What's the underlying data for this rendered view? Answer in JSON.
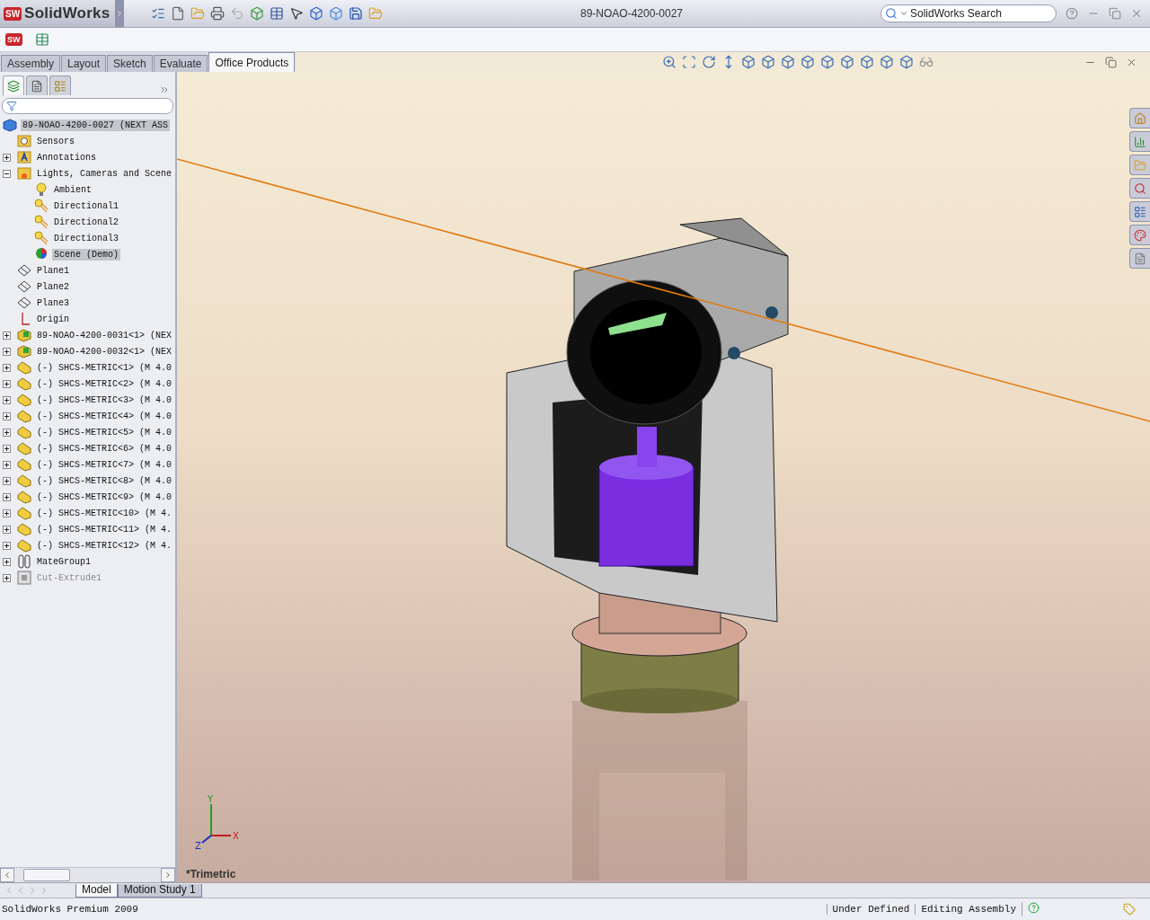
{
  "app": {
    "logo_mark": "SW",
    "logo": "SolidWorks",
    "document_title": "89-NOAO-4200-0027",
    "search": {
      "placeholder": "SolidWorks Search"
    },
    "menu_mark": "SW"
  },
  "command_tabs": [
    {
      "label": "Assembly",
      "selected": false
    },
    {
      "label": "Layout",
      "selected": false
    },
    {
      "label": "Sketch",
      "selected": false
    },
    {
      "label": "Evaluate",
      "selected": false
    },
    {
      "label": "Office Products",
      "selected": true
    }
  ],
  "panel_tabs": [
    {
      "kind": "feature-manager",
      "selected": true
    },
    {
      "kind": "property-manager",
      "selected": false
    },
    {
      "kind": "configuration-manager",
      "selected": false
    }
  ],
  "tree": {
    "root": {
      "label": "89-NOAO-4200-0027  (NEXT ASS",
      "kind": "assembly",
      "selected": true
    },
    "items": [
      {
        "label": "Sensors",
        "kind": "sensors",
        "selected": false
      },
      {
        "label": "Annotations",
        "kind": "annotations",
        "selected": false,
        "expanded": false
      },
      {
        "label": "Lights, Cameras and Scene",
        "kind": "lights",
        "selected": false,
        "expanded": true,
        "children": [
          {
            "label": "Ambient",
            "kind": "ambient",
            "selected": false
          },
          {
            "label": "Directional1",
            "kind": "directional",
            "selected": false
          },
          {
            "label": "Directional2",
            "kind": "directional",
            "selected": false
          },
          {
            "label": "Directional3",
            "kind": "directional",
            "selected": false
          },
          {
            "label": "Scene (Demo)",
            "kind": "scene",
            "selected": true
          }
        ]
      },
      {
        "label": "Plane1",
        "kind": "plane",
        "selected": false
      },
      {
        "label": "Plane2",
        "kind": "plane",
        "selected": false
      },
      {
        "label": "Plane3",
        "kind": "plane",
        "selected": false
      },
      {
        "label": "Origin",
        "kind": "origin",
        "selected": false
      },
      {
        "label": "89-NOAO-4200-0031<1>  (NEX",
        "kind": "part",
        "selected": false,
        "expanded": false
      },
      {
        "label": "89-NOAO-4200-0032<1>  (NEX",
        "kind": "part",
        "selected": false,
        "expanded": false
      },
      {
        "label": "(-) SHCS-METRIC<1>  (M 4.0",
        "kind": "fastener",
        "selected": false,
        "expanded": false
      },
      {
        "label": "(-) SHCS-METRIC<2>  (M 4.0",
        "kind": "fastener",
        "selected": false,
        "expanded": false
      },
      {
        "label": "(-) SHCS-METRIC<3>  (M 4.0",
        "kind": "fastener",
        "selected": false,
        "expanded": false
      },
      {
        "label": "(-) SHCS-METRIC<4>  (M 4.0",
        "kind": "fastener",
        "selected": false,
        "expanded": false
      },
      {
        "label": "(-) SHCS-METRIC<5>  (M 4.0",
        "kind": "fastener",
        "selected": false,
        "expanded": false
      },
      {
        "label": "(-) SHCS-METRIC<6>  (M 4.0",
        "kind": "fastener",
        "selected": false,
        "expanded": false
      },
      {
        "label": "(-) SHCS-METRIC<7>  (M 4.0",
        "kind": "fastener",
        "selected": false,
        "expanded": false
      },
      {
        "label": "(-) SHCS-METRIC<8>  (M 4.0",
        "kind": "fastener",
        "selected": false,
        "expanded": false
      },
      {
        "label": "(-) SHCS-METRIC<9>  (M 4.0",
        "kind": "fastener",
        "selected": false,
        "expanded": false
      },
      {
        "label": "(-) SHCS-METRIC<10>  (M 4.",
        "kind": "fastener",
        "selected": false,
        "expanded": false
      },
      {
        "label": "(-) SHCS-METRIC<11>  (M 4.",
        "kind": "fastener",
        "selected": false,
        "expanded": false
      },
      {
        "label": "(-) SHCS-METRIC<12>  (M 4.",
        "kind": "fastener",
        "selected": false,
        "expanded": false
      },
      {
        "label": "MateGroup1",
        "kind": "mategroup",
        "selected": false,
        "expanded": false
      },
      {
        "label": "Cut-Extrude1",
        "kind": "feature",
        "selected": false,
        "expanded": false,
        "suppressed": true
      }
    ]
  },
  "viewport": {
    "view_name": "*Trimetric",
    "triad": {
      "y": "Y",
      "x": "X",
      "z": "Z"
    }
  },
  "model_tabs": [
    {
      "label": "Model",
      "selected": true
    },
    {
      "label": "Motion Study 1",
      "selected": false
    }
  ],
  "status_bar": {
    "product": "SolidWorks Premium 2009",
    "fields": [
      "Under Defined",
      "Editing Assembly"
    ]
  }
}
